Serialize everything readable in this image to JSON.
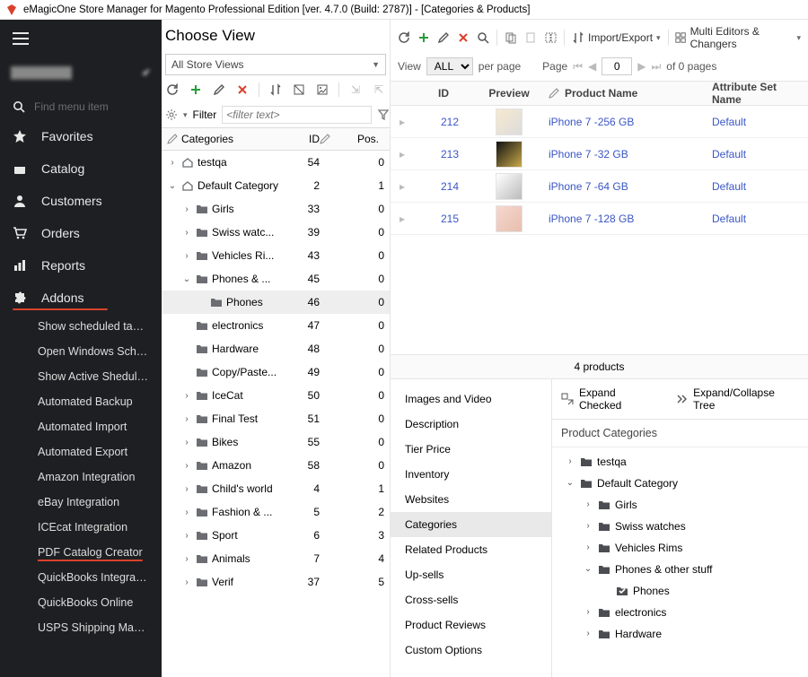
{
  "app": {
    "title": "eMagicOne Store Manager for Magento Professional Edition [ver. 4.7.0 (Build: 2787)] - [Categories & Products]"
  },
  "sidebar": {
    "search_placeholder": "Find menu item",
    "nav": [
      {
        "icon": "star",
        "label": "Favorites"
      },
      {
        "icon": "catalog",
        "label": "Catalog"
      },
      {
        "icon": "person",
        "label": "Customers"
      },
      {
        "icon": "cart",
        "label": "Orders"
      },
      {
        "icon": "chart",
        "label": "Reports"
      },
      {
        "icon": "puzzle",
        "label": "Addons"
      }
    ],
    "addons_items": [
      "Show scheduled tasks",
      "Open Windows Scheduler",
      "Show Active Sheduled ...",
      "Automated Backup",
      "Automated Import",
      "Automated Export",
      "Amazon Integration",
      "eBay Integration",
      "ICEcat Integration",
      "PDF Catalog Creator",
      "QuickBooks Integration",
      "QuickBooks Online",
      "USPS Shipping Manage..."
    ]
  },
  "center": {
    "heading": "Choose View",
    "storeview": "All Store Views",
    "filter_label": "Filter",
    "filter_placeholder": "<filter text>",
    "columns": {
      "cat": "Categories",
      "id": "ID",
      "pos": "Pos."
    },
    "tree": [
      {
        "depth": 0,
        "exp": ">",
        "type": "home",
        "name": "testqa",
        "id": 54,
        "pos": 0
      },
      {
        "depth": 0,
        "exp": "v",
        "type": "home",
        "name": "Default Category",
        "id": 2,
        "pos": 1
      },
      {
        "depth": 1,
        "exp": ">",
        "type": "folder",
        "name": "Girls",
        "id": 33,
        "pos": 0
      },
      {
        "depth": 1,
        "exp": ">",
        "type": "folder",
        "name": "Swiss watc...",
        "id": 39,
        "pos": 0
      },
      {
        "depth": 1,
        "exp": ">",
        "type": "folder",
        "name": "Vehicles Ri...",
        "id": 43,
        "pos": 0
      },
      {
        "depth": 1,
        "exp": "v",
        "type": "folder",
        "name": "Phones & ...",
        "id": 45,
        "pos": 0
      },
      {
        "depth": 2,
        "exp": "",
        "type": "folder",
        "name": "Phones",
        "id": 46,
        "pos": 0,
        "selected": true
      },
      {
        "depth": 1,
        "exp": "",
        "type": "folder",
        "name": "electronics",
        "id": 47,
        "pos": 0
      },
      {
        "depth": 1,
        "exp": "",
        "type": "folder",
        "name": "Hardware",
        "id": 48,
        "pos": 0
      },
      {
        "depth": 1,
        "exp": "",
        "type": "folder",
        "name": "Copy/Paste...",
        "id": 49,
        "pos": 0
      },
      {
        "depth": 1,
        "exp": ">",
        "type": "folder",
        "name": "IceCat",
        "id": 50,
        "pos": 0
      },
      {
        "depth": 1,
        "exp": ">",
        "type": "folder",
        "name": "Final Test",
        "id": 51,
        "pos": 0
      },
      {
        "depth": 1,
        "exp": ">",
        "type": "folder",
        "name": "Bikes",
        "id": 55,
        "pos": 0
      },
      {
        "depth": 1,
        "exp": ">",
        "type": "folder",
        "name": "Amazon",
        "id": 58,
        "pos": 0
      },
      {
        "depth": 1,
        "exp": ">",
        "type": "folder",
        "name": "Child's world",
        "id": 4,
        "pos": 1
      },
      {
        "depth": 1,
        "exp": ">",
        "type": "folder",
        "name": "Fashion & ...",
        "id": 5,
        "pos": 2
      },
      {
        "depth": 1,
        "exp": ">",
        "type": "folder",
        "name": "Sport",
        "id": 6,
        "pos": 3
      },
      {
        "depth": 1,
        "exp": ">",
        "type": "folder",
        "name": "Animals",
        "id": 7,
        "pos": 4
      },
      {
        "depth": 1,
        "exp": ">",
        "type": "folder",
        "name": "Verif",
        "id": 37,
        "pos": 5
      }
    ]
  },
  "right": {
    "import_export": "Import/Export",
    "multi": "Multi Editors & Changers",
    "viewrow": {
      "view": "View",
      "all": "ALL",
      "perpage": "per page",
      "page": "Page",
      "pagenum": "0",
      "of": "of 0 pages"
    },
    "columns": {
      "id": "ID",
      "preview": "Preview",
      "name": "Product Name",
      "attr": "Attribute Set Name"
    },
    "rows": [
      {
        "id": 212,
        "name": "iPhone 7 -256 GB",
        "attr": "Default",
        "thumb": ""
      },
      {
        "id": 213,
        "name": "iPhone 7 -32 GB",
        "attr": "Default",
        "thumb": "dark"
      },
      {
        "id": 214,
        "name": "iPhone 7 -64 GB",
        "attr": "Default",
        "thumb": "grayish"
      },
      {
        "id": 215,
        "name": "iPhone 7 -128 GB",
        "attr": "Default",
        "thumb": "pink"
      }
    ],
    "count": "4 products"
  },
  "bottom": {
    "tabs": [
      "Images and Video",
      "Description",
      "Tier Price",
      "Inventory",
      "Websites",
      "Categories",
      "Related Products",
      "Up-sells",
      "Cross-sells",
      "Product Reviews",
      "Custom Options"
    ],
    "active_tab": "Categories",
    "expand_checked": "Expand Checked",
    "expand_collapse": "Expand/Collapse Tree",
    "pc_heading": "Product Categories",
    "pc_tree": [
      {
        "depth": 0,
        "exp": ">",
        "name": "testqa",
        "checked": false
      },
      {
        "depth": 0,
        "exp": "v",
        "name": "Default Category",
        "checked": false
      },
      {
        "depth": 1,
        "exp": ">",
        "name": "Girls",
        "checked": false
      },
      {
        "depth": 1,
        "exp": ">",
        "name": "Swiss watches",
        "checked": false
      },
      {
        "depth": 1,
        "exp": ">",
        "name": "Vehicles Rims",
        "checked": false
      },
      {
        "depth": 1,
        "exp": "v",
        "name": "Phones & other stuff",
        "checked": false
      },
      {
        "depth": 2,
        "exp": "",
        "name": "Phones",
        "checked": true
      },
      {
        "depth": 1,
        "exp": ">",
        "name": "electronics",
        "checked": false
      },
      {
        "depth": 1,
        "exp": ">",
        "name": "Hardware",
        "checked": false
      }
    ]
  }
}
